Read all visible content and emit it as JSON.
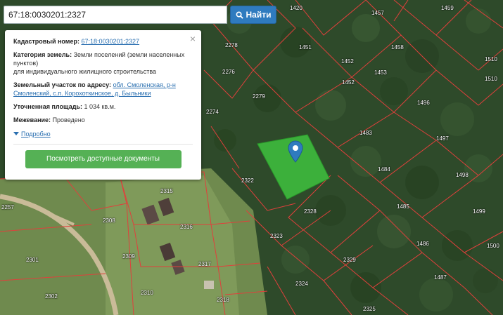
{
  "search": {
    "value": "67:18:0030201:2327",
    "button_label": "Найти",
    "button_icon": "search-icon"
  },
  "popup": {
    "cadastral_label": "Кадастровый номер:",
    "cadastral_value": "67:18:0030201:2327",
    "category_label": "Категория земель:",
    "category_value": "Земли поселений (земли населенных пунктов)",
    "category_usage": "для индивидуального жилищного строительства",
    "address_label": "Земельный участок по адресу:",
    "address_value": "обл. Смоленская, р-н Смоленский, с.п. Корохоткинское, д. Быльники",
    "area_label": "Уточненная площадь:",
    "area_value": "1 034 кв.м.",
    "survey_label": "Межевание:",
    "survey_value": "Проведено",
    "details_label": "Подробно",
    "docs_button": "Посмотреть доступные документы",
    "close_symbol": "×"
  },
  "map": {
    "selected_plot_color": "#3ec23e",
    "boundary_color": "#e0403c",
    "plot_numbers": [
      "1420",
      "1457",
      "1459",
      "2278",
      "1451",
      "1458",
      "1452",
      "1510",
      "2276",
      "1453",
      "1452",
      "1510",
      "2279",
      "1496",
      "2274",
      "1483",
      "1497",
      "2322",
      "1484",
      "1498",
      "2328",
      "1485",
      "1499",
      "2257",
      "2308",
      "2315",
      "2316",
      "2323",
      "1486",
      "1500",
      "2301",
      "2309",
      "2317",
      "2329",
      "2302",
      "2310",
      "2324",
      "1487",
      "2318",
      "2325"
    ]
  },
  "colors": {
    "search_button": "#2f7bbf",
    "docs_button": "#55b155",
    "link": "#2a6fb0"
  }
}
